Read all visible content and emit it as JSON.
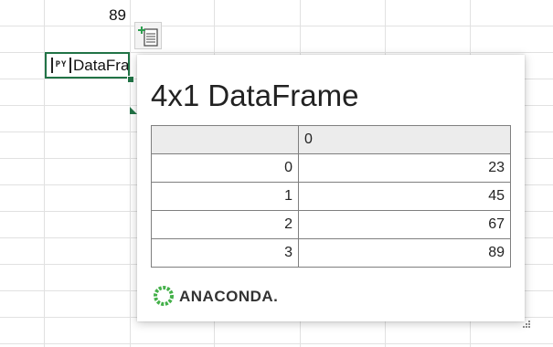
{
  "sheet": {
    "cell_above_value": "89",
    "selected_cell": {
      "badge": "PY",
      "text": "DataFrame"
    }
  },
  "card": {
    "title": "4x1 DataFrame",
    "table": {
      "columns": [
        "",
        "0"
      ],
      "rows": [
        [
          "0",
          "23"
        ],
        [
          "1",
          "45"
        ],
        [
          "2",
          "67"
        ],
        [
          "3",
          "89"
        ]
      ]
    },
    "brand": "ANACONDA."
  },
  "colors": {
    "selection": "#217346",
    "header_bg": "#ececec",
    "brand_green": "#43b049"
  },
  "icons": {
    "insert_data": "insert-data-icon",
    "brand": "anaconda-ring-icon",
    "resize": "resize-grip-icon"
  }
}
